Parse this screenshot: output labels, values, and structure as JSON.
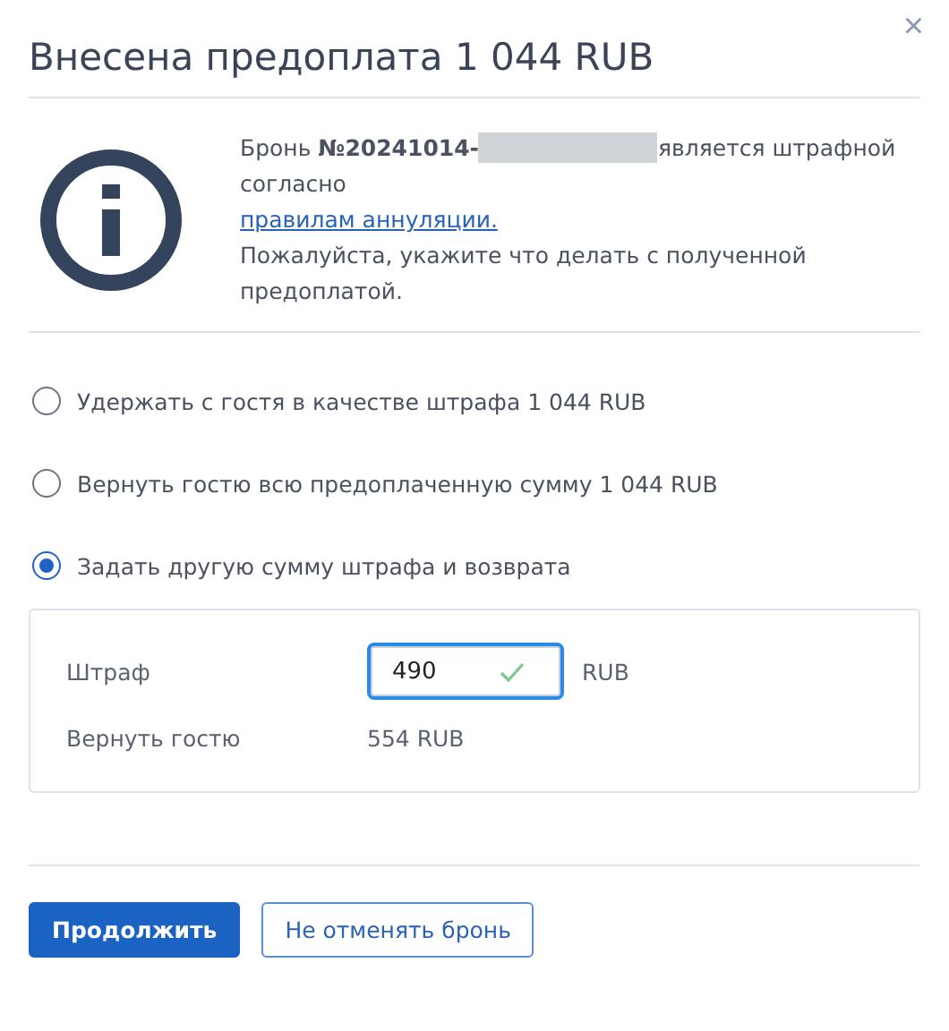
{
  "dialog": {
    "title": "Внесена предоплата 1 044 RUB",
    "close": "×"
  },
  "notice": {
    "booking_prefix": "Бронь **№20241014-**",
    "booking_suffix": "является штрафной согласно",
    "link": "правилам аннуляции.",
    "message": "Пожалуйста, укажите что делать с полученной предоплатой."
  },
  "options": [
    {
      "label": "Удержать с гостя в качестве штрафа 1 044 RUB",
      "selected": false
    },
    {
      "label": "Вернуть гостю всю предоплаченную сумму 1 044 RUB",
      "selected": false
    },
    {
      "label": "Задать другую сумму штрафа и возврата",
      "selected": true
    }
  ],
  "custom": {
    "penalty_label": "Штраф",
    "penalty_value": "490",
    "penalty_valid": true,
    "penalty_currency": "RUB",
    "refund_label": "Вернуть гостю",
    "refund_value": "554 RUB"
  },
  "buttons": [
    {
      "label": "Продолжить",
      "kind": "primary"
    },
    {
      "label": "Не отменять бронь",
      "kind": "secondary"
    }
  ]
}
